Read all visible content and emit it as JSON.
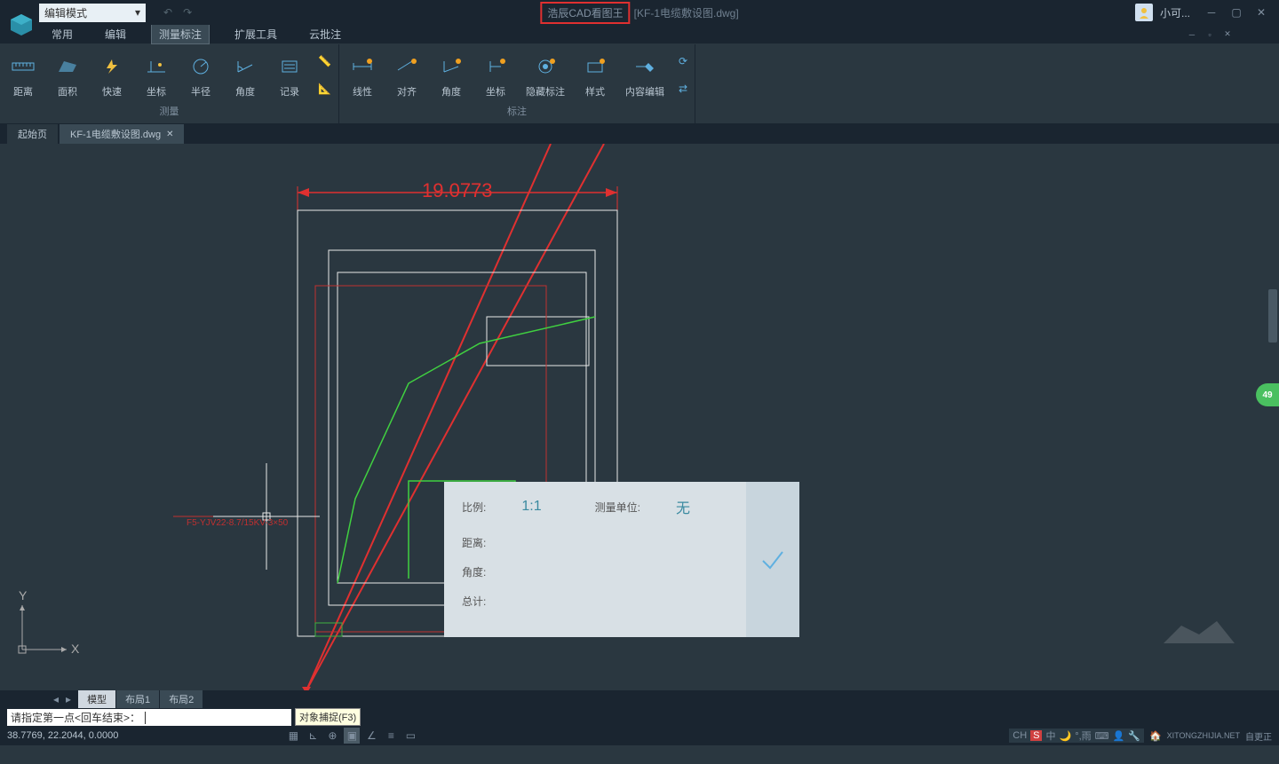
{
  "title": {
    "app_name": "浩辰CAD看图王",
    "file_name": "[KF-1电缆敷设图.dwg]",
    "mode": "编辑模式",
    "user": "小可..."
  },
  "menu": {
    "items": [
      "常用",
      "编辑",
      "测量标注",
      "扩展工具",
      "云批注"
    ],
    "active_index": 2
  },
  "ribbon": {
    "group_measure": {
      "label": "测量",
      "buttons": [
        {
          "label": "距离",
          "icon": "ruler"
        },
        {
          "label": "面积",
          "icon": "area"
        },
        {
          "label": "快速",
          "icon": "quick"
        },
        {
          "label": "坐标",
          "icon": "coord"
        },
        {
          "label": "半径",
          "icon": "radius"
        },
        {
          "label": "角度",
          "icon": "angle"
        },
        {
          "label": "记录",
          "icon": "record"
        }
      ]
    },
    "group_annotate": {
      "label": "标注",
      "buttons": [
        {
          "label": "线性",
          "icon": "linear"
        },
        {
          "label": "对齐",
          "icon": "align"
        },
        {
          "label": "角度",
          "icon": "angle2"
        },
        {
          "label": "坐标",
          "icon": "coord2"
        },
        {
          "label": "隐藏标注",
          "icon": "hide"
        },
        {
          "label": "样式",
          "icon": "style"
        },
        {
          "label": "内容编辑",
          "icon": "edit"
        }
      ]
    }
  },
  "file_tabs": {
    "items": [
      "起始页",
      "KF-1电缆敷设图.dwg"
    ],
    "active_index": 1
  },
  "canvas": {
    "dimension_label": "19.0773",
    "text_annotation": "F5-YJV22-8.7/15KV-3×50",
    "ucs_y": "Y",
    "ucs_x": "X"
  },
  "measure_panel": {
    "ratio_label": "比例:",
    "ratio_value": "1:1",
    "unit_label": "测量单位:",
    "unit_value": "无",
    "distance_label": "距离:",
    "angle_label": "角度:",
    "total_label": "总计:"
  },
  "layout_tabs": {
    "items": [
      "模型",
      "布局1",
      "布局2"
    ],
    "active_index": 0
  },
  "command": {
    "prompt": "请指定第一点<回车结束>：",
    "tooltip": "对象捕捉(F3)"
  },
  "status": {
    "coords": "38.7769, 22.2044, 0.0000",
    "ime": "CH",
    "ime2": "中",
    "weather": "°,雨",
    "brand": "XITONGZHIJIA.NET",
    "brand2": "自更正"
  },
  "badge": "49"
}
